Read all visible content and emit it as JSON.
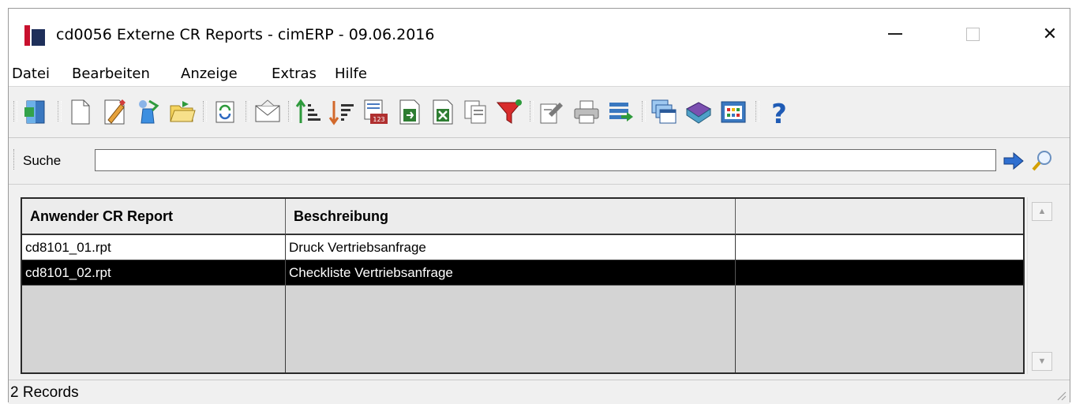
{
  "window": {
    "title": "cd0056 Externe CR Reports - cimERP - 09.06.2016",
    "controls": {
      "minimize": "—",
      "maximize": "☐",
      "close": "✕"
    }
  },
  "menu": [
    "Datei",
    "Bearbeiten",
    "Anzeige",
    "Extras",
    "Hilfe"
  ],
  "toolbar": {
    "icons": [
      "exit-door-icon",
      "new-document-icon",
      "edit-pencil-icon",
      "copy-record-icon",
      "open-folder-icon",
      "refresh-icon",
      "mail-envelope-icon",
      "sort-ascending-icon",
      "sort-descending-icon",
      "calendar-123-icon",
      "export-icon",
      "excel-icon",
      "copy-pages-icon",
      "filter-funnel-icon",
      "properties-icon",
      "print-icon",
      "list-arrow-icon",
      "windows-icon",
      "book-icon",
      "grid-view-icon",
      "help-icon"
    ]
  },
  "search": {
    "label": "Suche",
    "value": ""
  },
  "grid": {
    "columns": [
      "Anwender CR Report",
      "Beschreibung",
      ""
    ],
    "rows": [
      {
        "report": "cd8101_01.rpt",
        "description": "Druck Vertriebsanfrage",
        "extra": "",
        "selected": false
      },
      {
        "report": "cd8101_02.rpt",
        "description": "Checkliste Vertriebsanfrage",
        "extra": "",
        "selected": true
      }
    ]
  },
  "status": {
    "text": "2 Records"
  },
  "colors": {
    "logo_red": "#c8102e",
    "logo_navy": "#1e2f5a",
    "selection": "#000000"
  }
}
